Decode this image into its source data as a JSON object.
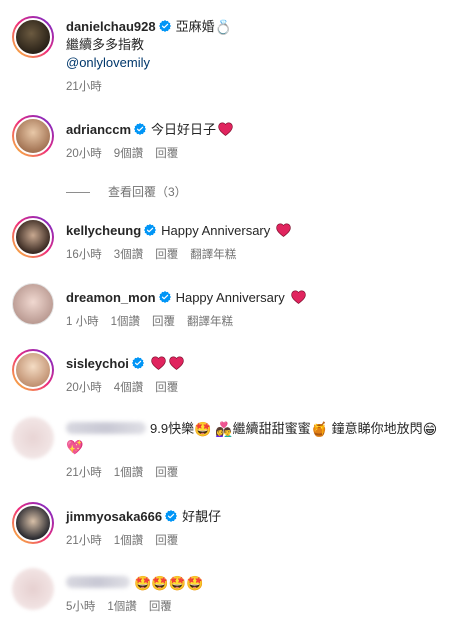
{
  "comments": [
    {
      "username": "danielchau928",
      "text": "亞麻婚",
      "emoji": "💍",
      "line2": "繼續多多指教",
      "mention": "@onlylovemily",
      "meta": {
        "time": "21小時"
      }
    },
    {
      "username": "adrianccm",
      "text": "今日好日子",
      "meta": {
        "time": "20小時",
        "likes": "9個讚",
        "reply": "回覆"
      }
    },
    {
      "username": "kellycheung",
      "text": "Happy Anniversary",
      "meta": {
        "time": "16小時",
        "likes": "3個讚",
        "reply": "回覆",
        "translate": "翻譯年糕"
      }
    },
    {
      "username": "dreamon_mon",
      "text": "Happy Anniversary",
      "meta": {
        "time": "1 小時",
        "likes": "1個讚",
        "reply": "回覆",
        "translate": "翻譯年糕"
      }
    },
    {
      "username": "sisleychoi",
      "text": "",
      "meta": {
        "time": "20小時",
        "likes": "4個讚",
        "reply": "回覆"
      }
    },
    {
      "username": "",
      "text_a": "9.9快樂",
      "text_b": "繼續甜甜蜜蜜",
      "text_c": "鐘意睇你地放閃",
      "emoji_a": "🤩",
      "emoji_b": "👩‍❤️‍👨",
      "emoji_c": "🍯",
      "emoji_d": "😁",
      "emoji_e": "💖",
      "meta": {
        "time": "21小時",
        "likes": "1個讚",
        "reply": "回覆"
      }
    },
    {
      "username": "jimmyosaka666",
      "text": "好靚仔",
      "meta": {
        "time": "21小時",
        "likes": "1個讚",
        "reply": "回覆"
      }
    },
    {
      "username": "",
      "emoji": "🤩🤩🤩🤩",
      "meta": {
        "time": "5小時",
        "likes": "1個讚",
        "reply": "回覆"
      }
    }
  ],
  "view_replies": "查看回覆（3）",
  "colors": {
    "heart": "#e0245e",
    "verified": "#0095f6",
    "mention": "#00376b",
    "meta": "#737373"
  }
}
